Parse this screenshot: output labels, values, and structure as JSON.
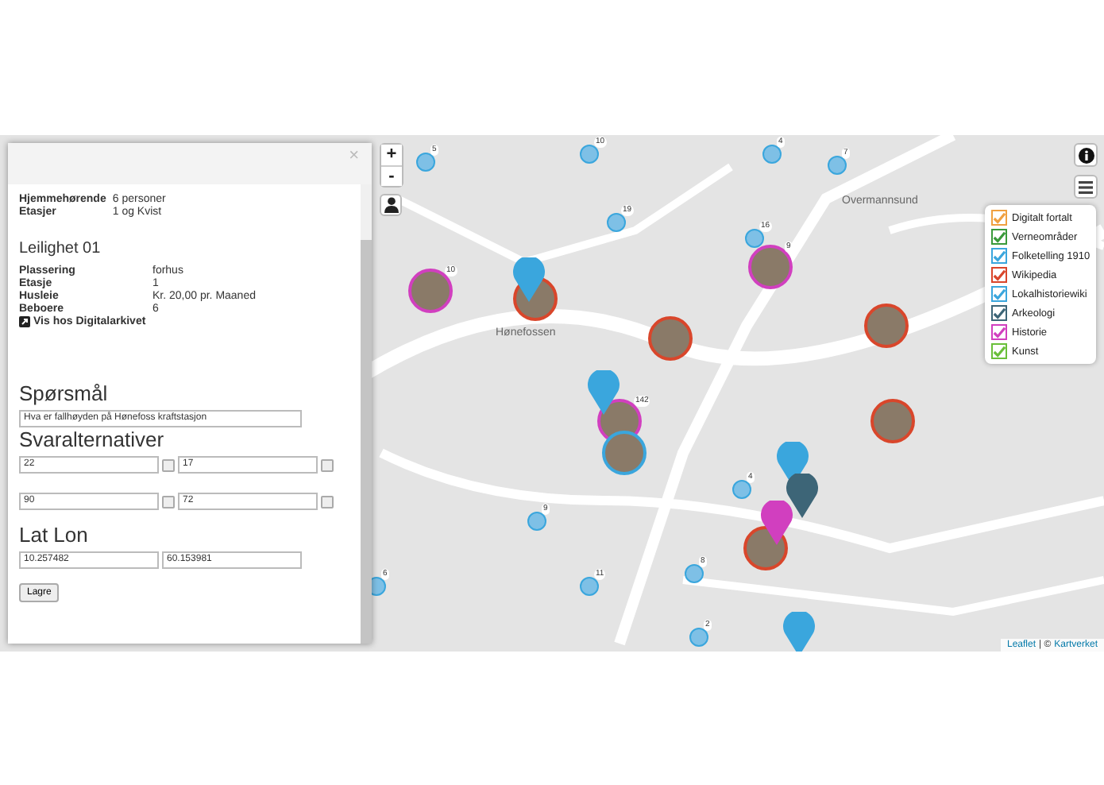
{
  "map": {
    "labels": [
      "Hønefossen",
      "Overmannsund"
    ],
    "markers": [
      {
        "kind": "cluster",
        "count": "5"
      },
      {
        "kind": "cluster",
        "count": "10"
      },
      {
        "kind": "cluster",
        "count": "4"
      },
      {
        "kind": "cluster",
        "count": "7"
      },
      {
        "kind": "cluster",
        "count": "19"
      },
      {
        "kind": "cluster",
        "count": "16"
      },
      {
        "kind": "cluster",
        "count": "9"
      },
      {
        "kind": "cluster",
        "count": "4"
      },
      {
        "kind": "cluster",
        "count": "8"
      },
      {
        "kind": "cluster",
        "count": "11"
      },
      {
        "kind": "cluster",
        "count": "2"
      },
      {
        "kind": "cluster",
        "count": "6"
      },
      {
        "kind": "photo",
        "color": "#d13fbf",
        "count": "10"
      },
      {
        "kind": "photo",
        "color": "#d9462b"
      },
      {
        "kind": "photo",
        "color": "#d13fbf",
        "count": "9"
      },
      {
        "kind": "photo",
        "color": "#d9462b"
      },
      {
        "kind": "photo",
        "color": "#d9462b"
      },
      {
        "kind": "photo",
        "color": "#d9462b"
      },
      {
        "kind": "photo",
        "color": "#d13fbf",
        "count": "142"
      },
      {
        "kind": "photo",
        "color": "#3aa6dd"
      },
      {
        "kind": "photo",
        "color": "#d9462b"
      },
      {
        "kind": "pin",
        "color": "#3aa6dd"
      },
      {
        "kind": "pin",
        "color": "#3aa6dd"
      },
      {
        "kind": "pin",
        "color": "#3aa6dd"
      },
      {
        "kind": "pin",
        "color": "#3d6577"
      },
      {
        "kind": "pin",
        "color": "#d13fbf"
      },
      {
        "kind": "pin",
        "color": "#3aa6dd"
      }
    ],
    "zoom": [
      "+",
      "-"
    ],
    "attribution": [
      {
        "kind": "link",
        "text": "Leaflet"
      },
      {
        "kind": "text",
        "text": "| ©"
      },
      {
        "kind": "link",
        "text": "Kartverket"
      }
    ]
  },
  "legend": [
    {
      "label": "Digitalt fortalt",
      "color": "#f0a040",
      "checked": true
    },
    {
      "label": "Verneområder",
      "color": "#3a9a3a",
      "checked": true
    },
    {
      "label": "Folketelling 1910",
      "color": "#3aa6dd",
      "checked": true
    },
    {
      "label": "Wikipedia",
      "color": "#d9462b",
      "checked": true
    },
    {
      "label": "Lokalhistoriewiki",
      "color": "#3aa6dd",
      "checked": true
    },
    {
      "label": "Arkeologi",
      "color": "#3d6577",
      "checked": true
    },
    {
      "label": "Historie",
      "color": "#d13fbf",
      "checked": true
    },
    {
      "label": "Kunst",
      "color": "#6abf3a",
      "checked": true
    }
  ],
  "panel": {
    "close": "×",
    "summary": [
      {
        "label": "Hjemmehørende",
        "value": "6 personer"
      },
      {
        "label": "Etasjer",
        "value": "1 og Kvist"
      }
    ],
    "apartment": {
      "title": "Leilighet 01",
      "fields": [
        {
          "label": "Plassering",
          "value": "forhus"
        },
        {
          "label": "Etasje",
          "value": "1"
        },
        {
          "label": "Husleie",
          "value": "Kr. 20,00 pr. Maaned"
        },
        {
          "label": "Beboere",
          "value": "6"
        }
      ],
      "link": "Vis hos Digitalarkivet"
    },
    "question": {
      "heading": "Spørsmål",
      "value": "Hva er fallhøyden på Hønefoss kraftstasjon"
    },
    "answers": {
      "heading": "Svaralternativer",
      "options": [
        {
          "value": "22",
          "checked": false
        },
        {
          "value": "17",
          "checked": false
        },
        {
          "value": "90",
          "checked": false
        },
        {
          "value": "72",
          "checked": false
        }
      ]
    },
    "latlon": {
      "heading": "Lat Lon",
      "lat": "10.257482",
      "lon": "60.153981"
    },
    "save": "Lagre"
  }
}
